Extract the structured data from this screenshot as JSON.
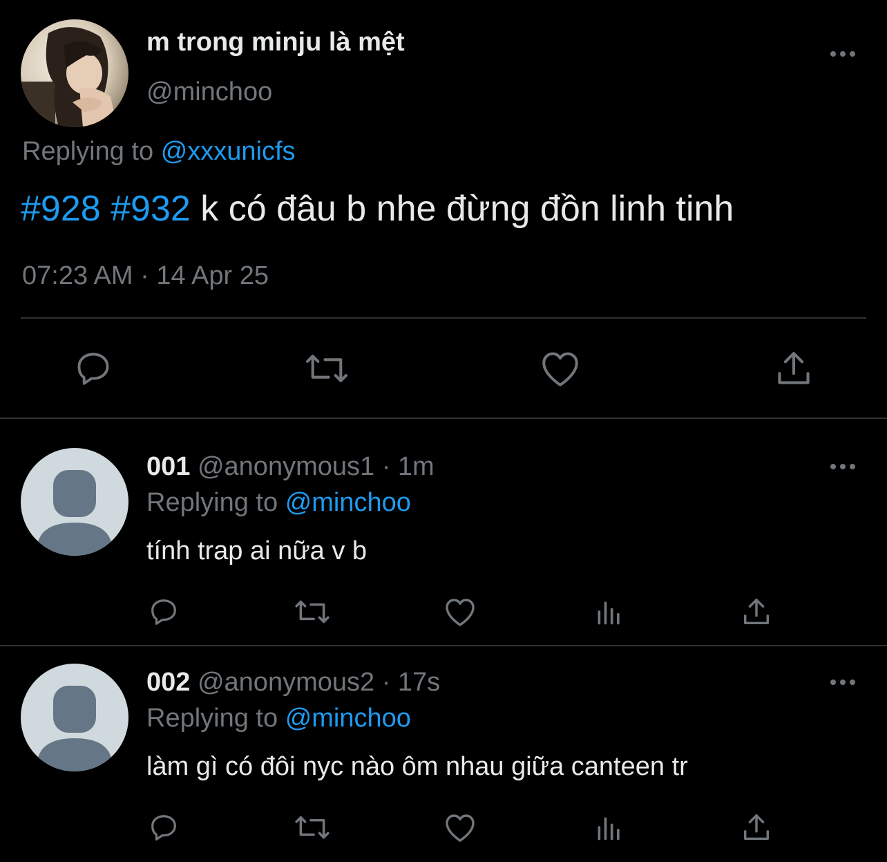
{
  "main_tweet": {
    "display_name": "m trong minju là mệt",
    "handle": "@minchoo",
    "replying_label": "Replying to",
    "replying_to": "@xxxunicfs",
    "hashtags": [
      "#928",
      "#932"
    ],
    "text": "k có đâu b nhe đừng đồn linh tinh",
    "timestamp": "07:23 AM · 14 Apr 25"
  },
  "replies": [
    {
      "display_name": "001",
      "handle": "@anonymous1",
      "time": "· 1m",
      "replying_label": "Replying to",
      "replying_to": "@minchoo",
      "text": "tính trap ai nữa v b"
    },
    {
      "display_name": "002",
      "handle": "@anonymous2",
      "time": "· 17s",
      "replying_label": "Replying to",
      "replying_to": "@minchoo",
      "text": "làm gì có đôi nyc nào ôm nhau giữa canteen tr"
    }
  ],
  "icons": {
    "more": "more-horizontal-icon",
    "reply": "reply-bubble-icon",
    "retweet": "retweet-icon",
    "like": "heart-icon",
    "views": "analytics-bars-icon",
    "share": "share-upload-icon"
  },
  "colors": {
    "background": "#000000",
    "text": "#e7e9ea",
    "secondary": "#71767b",
    "accent": "#1d9bf0",
    "divider": "#2f3336",
    "default_avatar_bg": "#cfd9de",
    "default_avatar_fg": "#657786"
  }
}
